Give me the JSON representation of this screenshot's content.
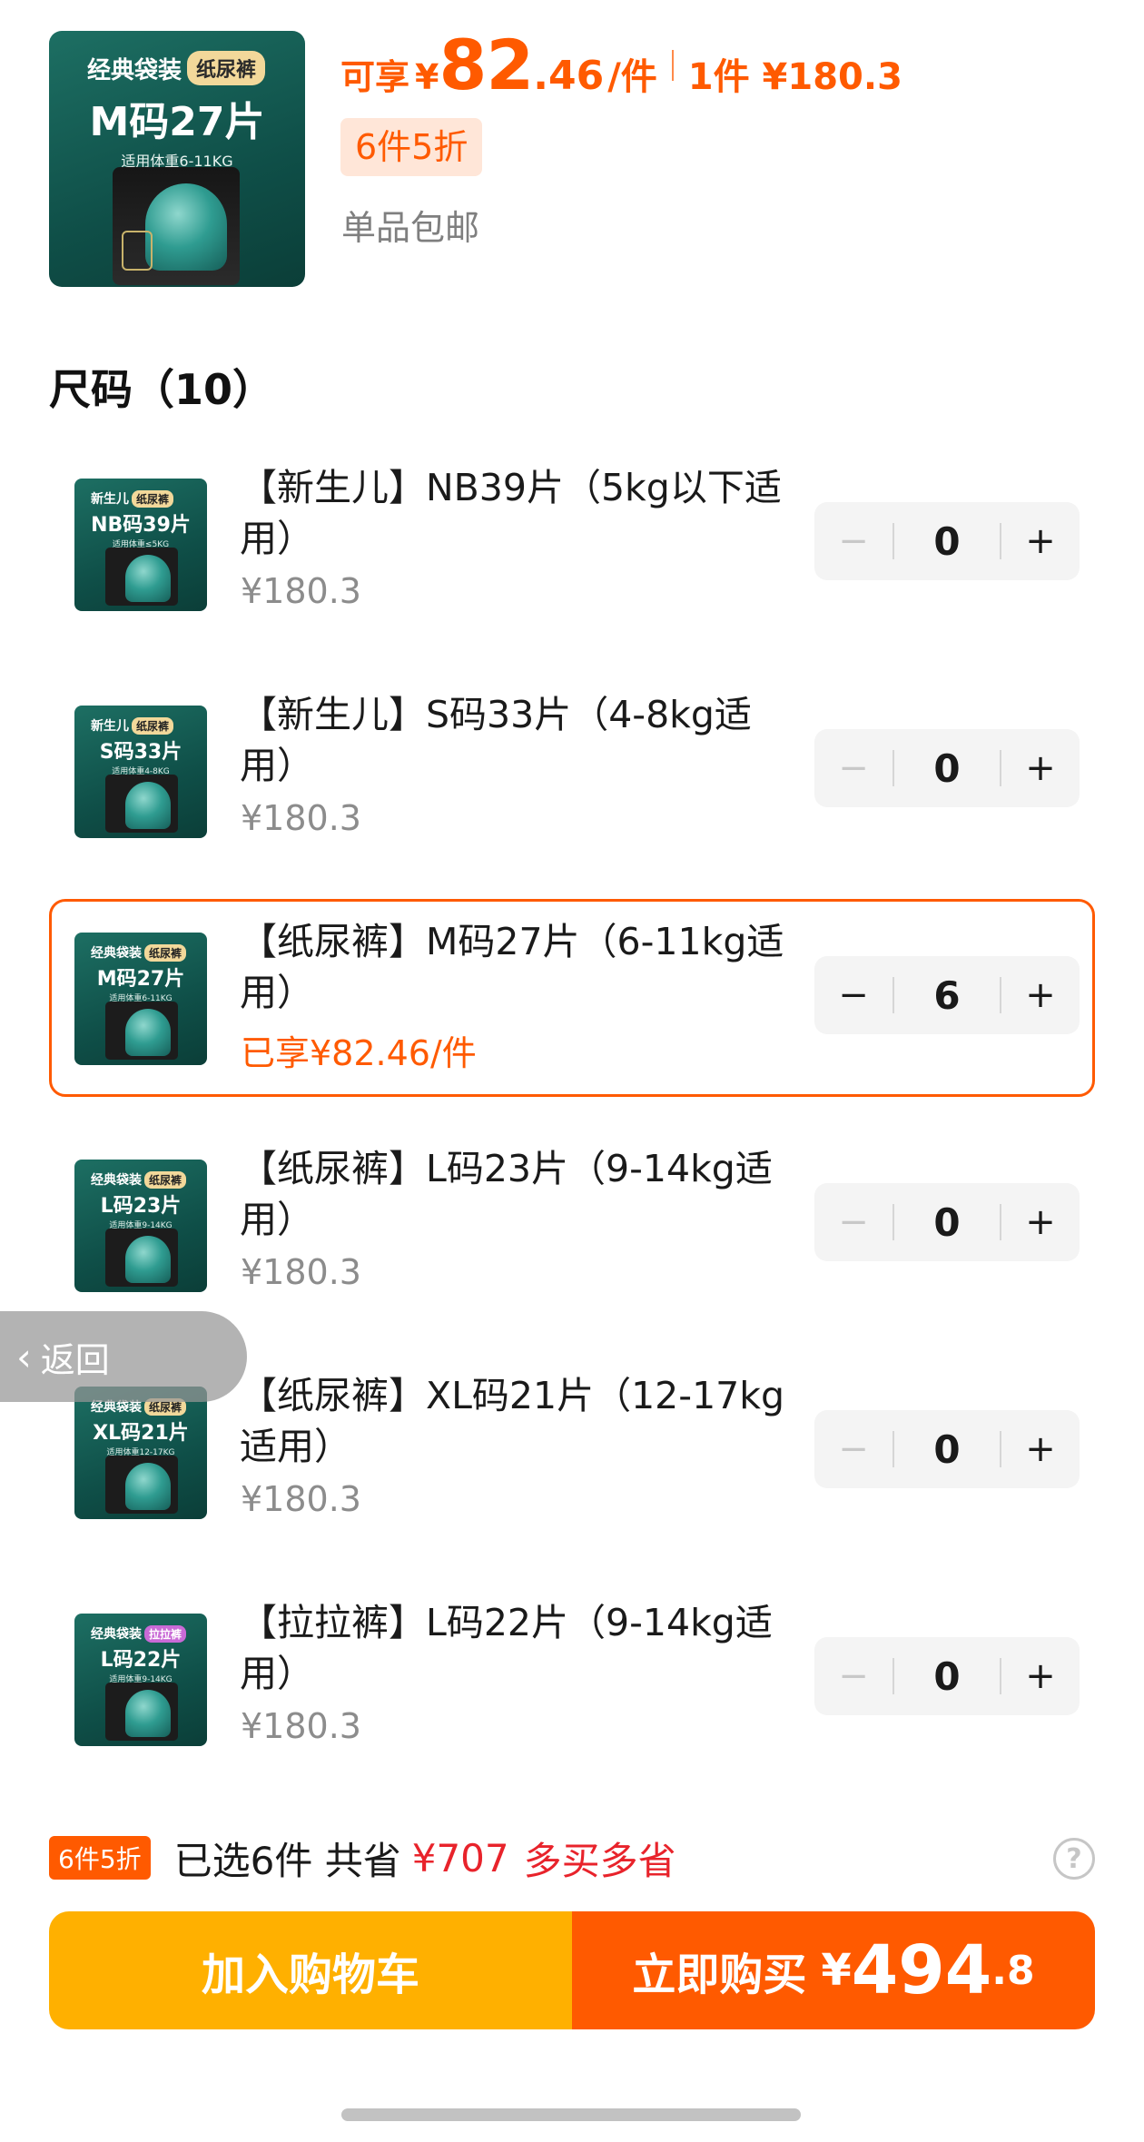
{
  "product": {
    "thumb_line1": "经典袋装",
    "thumb_tag": "纸尿裤",
    "thumb_big": "M码27片",
    "thumb_small": "适用体重6-11KG"
  },
  "price": {
    "label": "可享",
    "yen": "¥",
    "int": "82",
    "dec": ".46",
    "unit": "/件",
    "single": "1件 ¥180.3"
  },
  "promo_badge": "6件5折",
  "shipping": "单品包邮",
  "section": {
    "title": "尺码（10）"
  },
  "rows": [
    {
      "name": "【新生儿】NB39片（5kg以下适用）",
      "price": "¥180.3",
      "qty": "0",
      "minus": "−",
      "plus": "+",
      "thumb": {
        "l1": "新生儿",
        "tag": "纸尿裤",
        "big": "NB码39片",
        "small": "适用体重≤5KG"
      }
    },
    {
      "name": "【新生儿】S码33片（4-8kg适用）",
      "price": "¥180.3",
      "qty": "0",
      "minus": "−",
      "plus": "+",
      "thumb": {
        "l1": "新生儿",
        "tag": "纸尿裤",
        "big": "S码33片",
        "small": "适用体重4-8KG"
      }
    },
    {
      "name": "【纸尿裤】M码27片（6-11kg适用）",
      "price": "已享¥82.46/件",
      "qty": "6",
      "minus": "−",
      "plus": "+",
      "thumb": {
        "l1": "经典袋装",
        "tag": "纸尿裤",
        "big": "M码27片",
        "small": "适用体重6-11KG"
      }
    },
    {
      "name": "【纸尿裤】L码23片（9-14kg适用）",
      "price": "¥180.3",
      "qty": "0",
      "minus": "−",
      "plus": "+",
      "thumb": {
        "l1": "经典袋装",
        "tag": "纸尿裤",
        "big": "L码23片",
        "small": "适用体重9-14KG"
      }
    },
    {
      "name": "【纸尿裤】XL码21片（12-17kg适用）",
      "price": "¥180.3",
      "qty": "0",
      "minus": "−",
      "plus": "+",
      "thumb": {
        "l1": "经典袋装",
        "tag": "纸尿裤",
        "big": "XL码21片",
        "small": "适用体重12-17KG"
      }
    },
    {
      "name": "【拉拉裤】L码22片（9-14kg适用）",
      "price": "¥180.3",
      "qty": "0",
      "minus": "−",
      "plus": "+",
      "thumb": {
        "l1": "经典袋装",
        "tag": "拉拉裤",
        "big": "L码22片",
        "small": "适用体重9-14KG"
      }
    }
  ],
  "back": {
    "chevron": "‹",
    "label": "返回"
  },
  "summary": {
    "badge": "6件5折",
    "text": "已选6件 共省",
    "saved": "¥707",
    "more": "多买多省",
    "help_icon": "?"
  },
  "buttons": {
    "cart": "加入购物车",
    "buy_label": "立即购买",
    "buy_yen": "¥",
    "buy_int": "494",
    "buy_dec": ".8"
  },
  "colors": {
    "accent": "#ff5a00",
    "cart": "#ffb000",
    "savings": "#e8232b",
    "thumb_bg": "#0f4f48"
  }
}
